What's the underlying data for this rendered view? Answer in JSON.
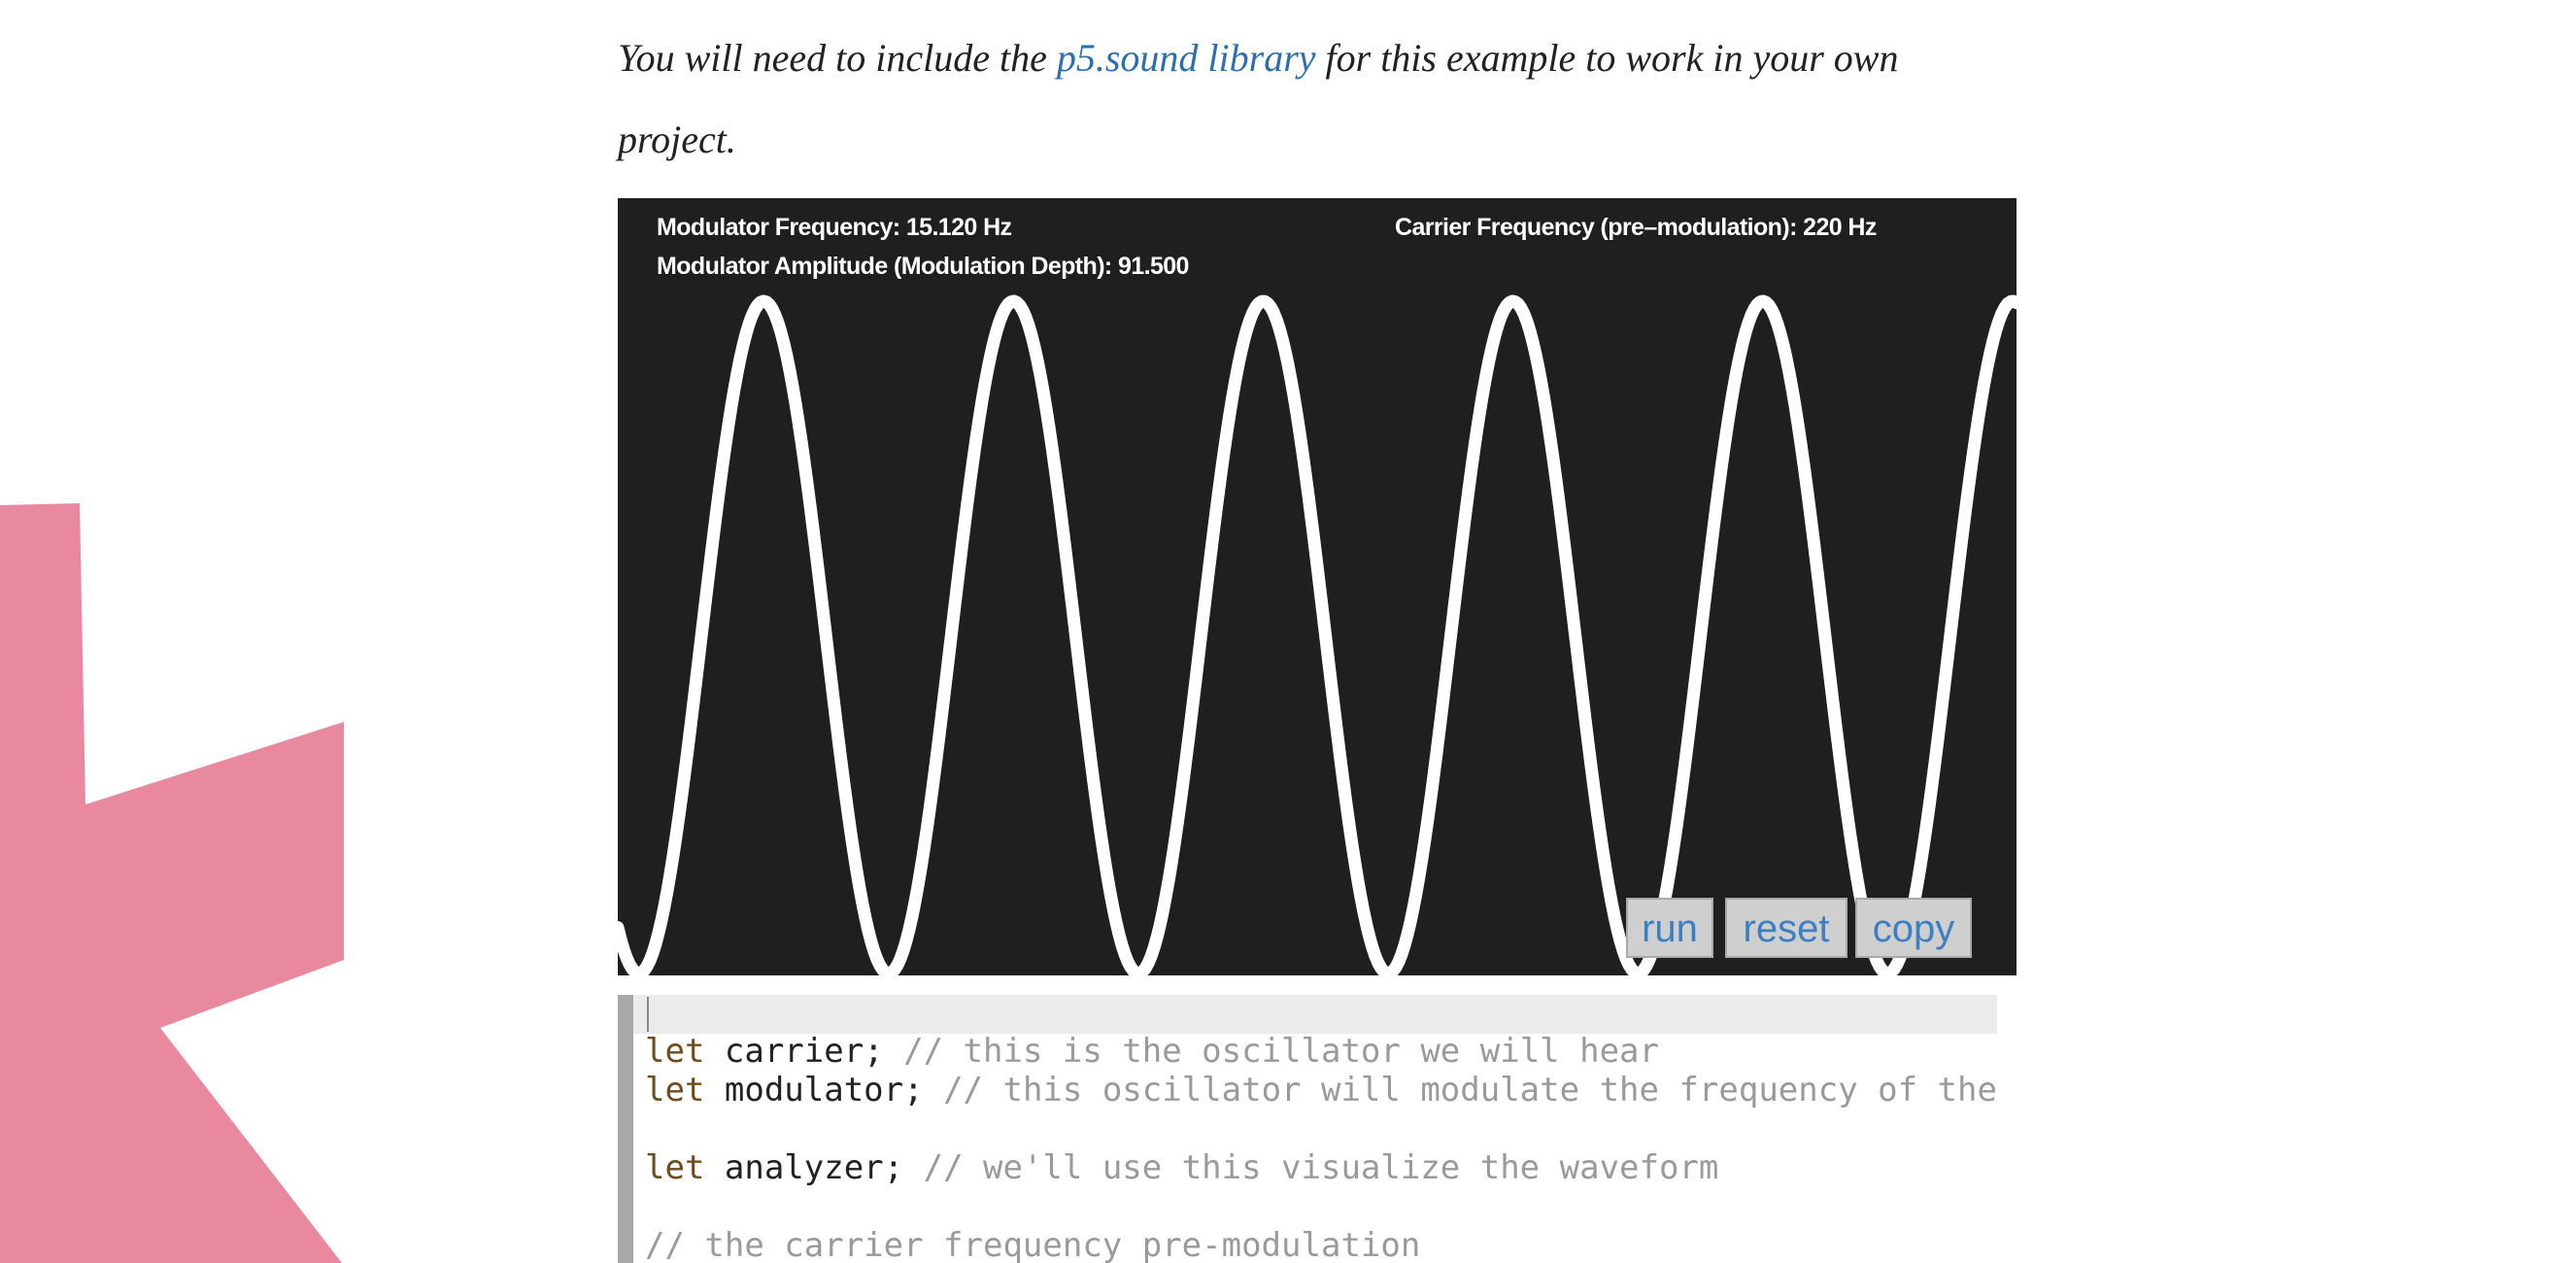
{
  "intro": {
    "before": "You will need to include the ",
    "link": "p5.sound library",
    "after": " for this example to work in your own project."
  },
  "sketch": {
    "modulator_frequency": "Modulator Frequency: 15.120 Hz",
    "modulator_amplitude": "Modulator Amplitude (Modulation Depth): 91.500",
    "carrier_frequency": "Carrier Frequency (pre–modulation): 220 Hz",
    "background": "#1f1f1f",
    "wave_color": "#ffffff"
  },
  "buttons": {
    "run": "run",
    "reset": "reset",
    "copy": "copy"
  },
  "code": {
    "lines": [
      {
        "keyword": "let",
        "name": " carrier;",
        "comment": " // this is the oscillator we will hear"
      },
      {
        "keyword": "let",
        "name": " modulator;",
        "comment": " // this oscillator will modulate the frequency of the c"
      },
      {
        "keyword": "",
        "name": "",
        "comment": ""
      },
      {
        "keyword": "let",
        "name": " analyzer;",
        "comment": " // we'll use this visualize the waveform"
      },
      {
        "keyword": "",
        "name": "",
        "comment": ""
      },
      {
        "keyword": "",
        "name": "",
        "comment": "// the carrier frequency pre-modulation"
      }
    ]
  },
  "colors": {
    "link": "#2c6fb0",
    "decor_star": "#e8899f",
    "keyword": "#704b1c",
    "comment": "#9a9a9a"
  }
}
